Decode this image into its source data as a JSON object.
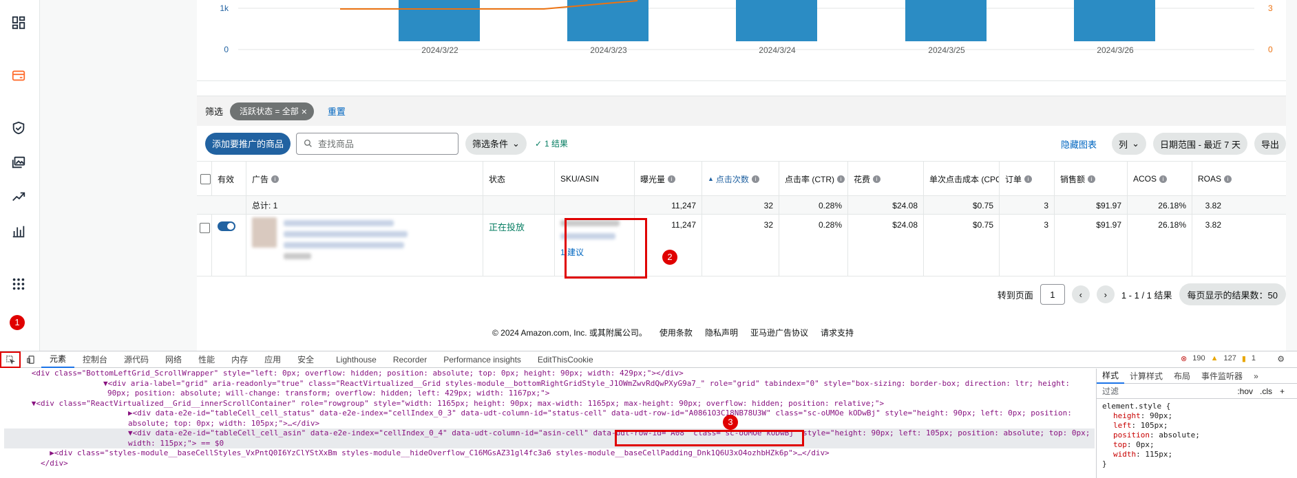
{
  "chart": {
    "left_axis_ticks": [
      "1k",
      "0"
    ],
    "right_axis_ticks": [
      "3",
      "0"
    ],
    "dates": [
      "2024/3/22",
      "2024/3/23",
      "2024/3/24",
      "2024/3/25",
      "2024/3/26"
    ],
    "bar_color": "#2b8cc4",
    "line_color": "#ec7211"
  },
  "filter": {
    "label": "筛选",
    "chip": "活跃状态 = 全部",
    "chip_close": "×",
    "reset": "重置"
  },
  "toolbar": {
    "add_button": "添加要推广的商品",
    "search_placeholder": "查找商品",
    "conditions": "筛选条件",
    "result_count": "1 结果",
    "hide_chart": "隐藏图表",
    "columns": "列",
    "date_range": "日期范围 - 最近 7 天",
    "export": "导出"
  },
  "table": {
    "headers": {
      "active": "有效",
      "ad": "广告",
      "status": "状态",
      "sku": "SKU/ASIN",
      "impressions": "曝光量",
      "clicks": "点击次数",
      "ctr": "点击率 (CTR)",
      "spend": "花费",
      "cpc": "单次点击成本 (CPC)",
      "orders": "订单",
      "sales": "销售额",
      "acos": "ACOS",
      "roas": "ROAS"
    },
    "total": {
      "label": "总计: 1",
      "impressions": "11,247",
      "clicks": "32",
      "ctr": "0.28%",
      "spend": "$24.08",
      "cpc": "$0.75",
      "orders": "3",
      "sales": "$91.97",
      "acos": "26.18%",
      "roas": "3.82"
    },
    "row": {
      "status": "正在投放",
      "suggestion": "1 建议",
      "impressions": "11,247",
      "clicks": "32",
      "ctr": "0.28%",
      "spend": "$24.08",
      "cpc": "$0.75",
      "orders": "3",
      "sales": "$91.97",
      "acos": "26.18%",
      "roas": "3.82"
    }
  },
  "pagination": {
    "goto_label": "转到页面",
    "page": "1",
    "range": "1 - 1 / 1 结果",
    "per_page": "每页显示的结果数：50"
  },
  "footer": {
    "copyright": "© 2024 Amazon.com, Inc. 或其附属公司。",
    "links": [
      "使用条款",
      "隐私声明",
      "亚马逊广告协议",
      "请求支持"
    ]
  },
  "markers": [
    "1",
    "2",
    "3"
  ],
  "devtools": {
    "tabs": [
      "元素",
      "控制台",
      "源代码",
      "网络",
      "性能",
      "内存",
      "应用",
      "安全",
      "Lighthouse",
      "Recorder",
      "Performance insights",
      "EditThisCookie"
    ],
    "errors": "190",
    "warnings": "127",
    "issues": "1",
    "styles_tabs": [
      "样式",
      "计算样式",
      "布局",
      "事件监听器"
    ],
    "filter_placeholder": "过滤",
    "hov": ":hov",
    "cls": ".cls",
    "rule_selector": "element.style {",
    "rule_props": [
      {
        "name": "height",
        "value": "90px;"
      },
      {
        "name": "left",
        "value": "105px;"
      },
      {
        "name": "position",
        "value": "absolute;"
      },
      {
        "name": "top",
        "value": "0px;"
      },
      {
        "name": "width",
        "value": "115px;"
      }
    ],
    "rule_end": "}",
    "code_lines": [
      "      <div class=\"BottomLeftGrid_ScrollWrapper\" style=\"left: 0px; overflow: hidden; position: absolute; top: 0px; height: 90px; width: 429px;\"></div>",
      "    ▼<div aria-label=\"grid\" aria-readonly=\"true\" class=\"ReactVirtualized__Grid styles-module__bottomRightGridStyle_J1OWmZwvRdQwPXyG9a7_\" role=\"grid\" tabindex=\"0\" style=\"box-sizing: border-box; direction: ltr; height: 90px; position: absolute; will-change: transform; overflow: hidden; left: 429px; width: 1167px;\">",
      "      ▼<div class=\"ReactVirtualized__Grid__innerScrollContainer\" role=\"rowgroup\" style=\"width: 1165px; height: 90px; max-width: 1165px; max-height: 90px; overflow: hidden; position: relative;\">",
      "        ▶<div data-e2e-id=\"tableCell_cell_status\" data-e2e-index=\"cellIndex_0_3\" data-udt-column-id=\"status-cell\" data-udt-row-id=\"A0861O3C18NB78U3W\" class=\"sc-oUMOe kODwBj\" style=\"height: 90px; left: 0px; position: absolute; top: 0px; width: 105px;\">…</div>",
      "        ▼<div data-e2e-id=\"tableCell_cell_asin\" data-e2e-index=\"cellIndex_0_4\" data-udt-column-id=\"asin-cell\" data-udt-row-id=\"A08\" class=\"sc-oUMOe kODwBj\" style=\"height: 90px; left: 105px; position: absolute; top: 0px; width: 115px;\"> == $0",
      "          ▶<div class=\"styles-module__baseCellStyles_VxPntQ0I6YzClYStXxBm styles-module__hideOverflow_C16MGsAZ31gl4fc3a6 styles-module__baseCellPadding_Dnk1Q6U3xO4ozhbHZk6p\">…</div>",
      "        </div>"
    ]
  }
}
